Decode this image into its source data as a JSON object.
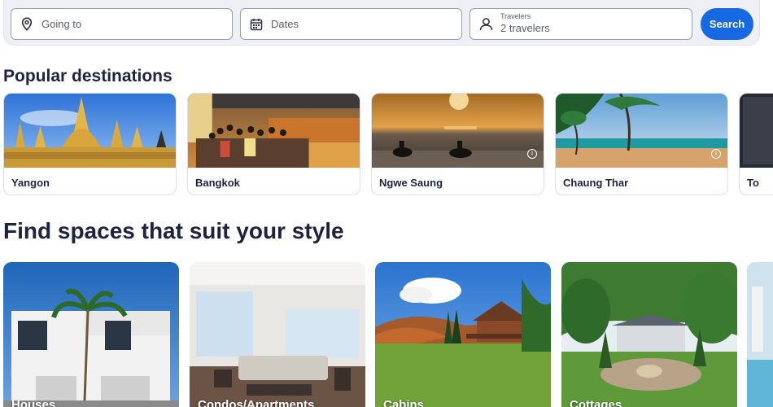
{
  "search": {
    "going_to_placeholder": "Going to",
    "dates_placeholder": "Dates",
    "travelers_label": "Travelers",
    "travelers_value": "2 travelers",
    "search_label": "Search"
  },
  "popular": {
    "heading": "Popular destinations",
    "items": [
      {
        "label": "Yangon"
      },
      {
        "label": "Bangkok"
      },
      {
        "label": "Ngwe Saung"
      },
      {
        "label": "Chaung Thar"
      },
      {
        "label": "To"
      }
    ]
  },
  "spaces": {
    "heading": "Find spaces that suit your style",
    "items": [
      {
        "label": "Houses"
      },
      {
        "label": "Condos/Apartments"
      },
      {
        "label": "Cabins"
      },
      {
        "label": "Cottages"
      }
    ]
  },
  "colors": {
    "accent": "#1668e3",
    "heading": "#1f2340",
    "panel": "#eef0f5"
  }
}
